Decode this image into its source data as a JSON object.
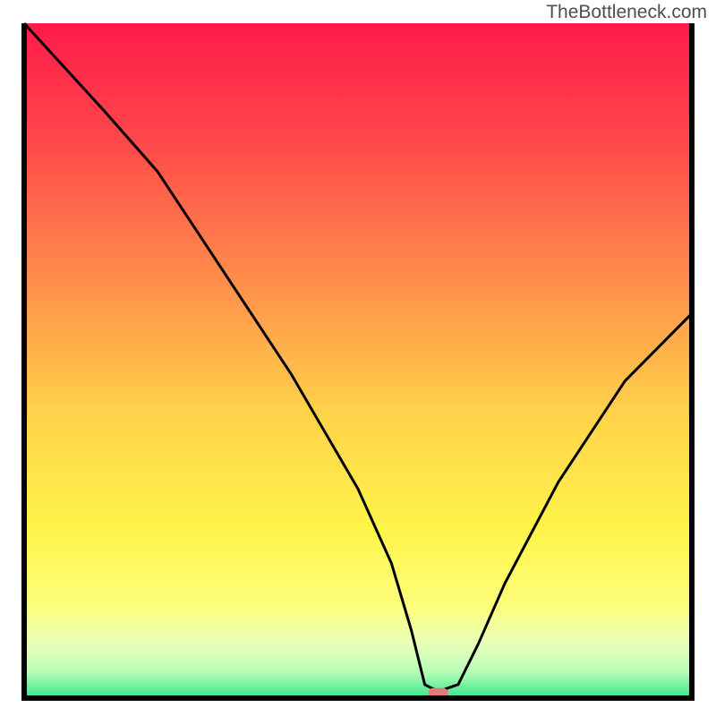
{
  "watermark": "TheBottleneck.com",
  "chart_data": {
    "type": "line",
    "title": "",
    "xlabel": "",
    "ylabel": "",
    "xlim": [
      0,
      100
    ],
    "ylim": [
      0,
      100
    ],
    "grid": false,
    "legend": false,
    "series": [
      {
        "name": "bottleneck-curve",
        "x": [
          0,
          12,
          20,
          30,
          40,
          50,
          55,
          58,
          60,
          62,
          65,
          68,
          72,
          80,
          90,
          100
        ],
        "values": [
          100,
          87,
          78,
          63,
          48,
          31,
          20,
          10,
          2,
          1,
          2,
          8,
          17,
          32,
          47,
          57
        ]
      }
    ],
    "marker": {
      "x": 62,
      "y": 0,
      "width_pct": 3,
      "height_pct": 1.5,
      "color": "#e27a79"
    },
    "gradient_stops": [
      {
        "offset": 0,
        "color": "#ff1a4a"
      },
      {
        "offset": 0.18,
        "color": "#ff4a4a"
      },
      {
        "offset": 0.4,
        "color": "#ff944a"
      },
      {
        "offset": 0.58,
        "color": "#ffd34a"
      },
      {
        "offset": 0.75,
        "color": "#fff44a"
      },
      {
        "offset": 0.86,
        "color": "#fdff7a"
      },
      {
        "offset": 0.92,
        "color": "#e9ffb8"
      },
      {
        "offset": 0.96,
        "color": "#b9ffb8"
      },
      {
        "offset": 1.0,
        "color": "#37e58d"
      }
    ],
    "frame_color": "#000000",
    "curve_color": "#000000"
  }
}
